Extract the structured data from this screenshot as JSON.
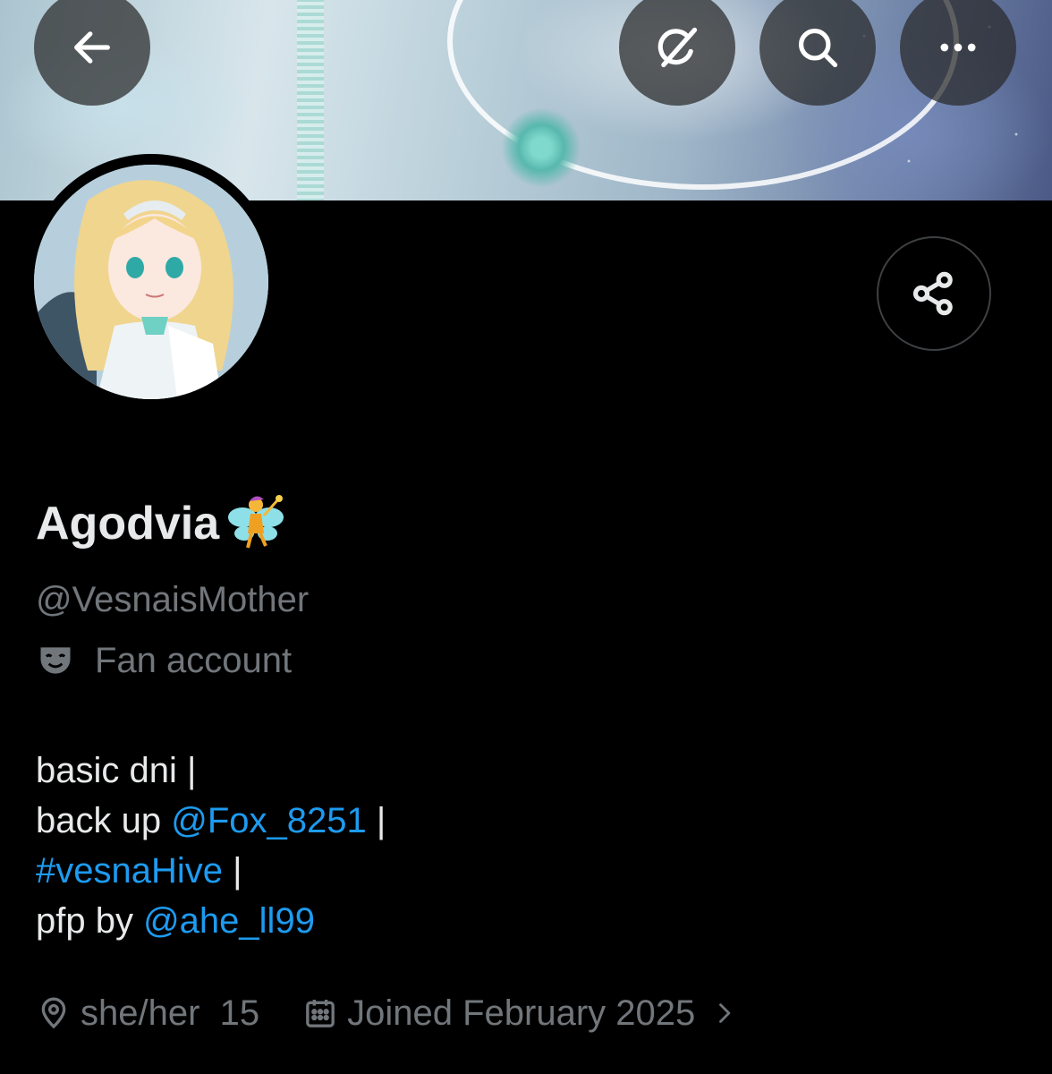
{
  "header": {
    "back_icon": "arrow-left-icon",
    "grok_icon": "grok-icon",
    "search_icon": "search-icon",
    "more_icon": "more-horizontal-icon"
  },
  "profile": {
    "display_name": "Agodvia",
    "display_name_emoji": "fairy-emoji",
    "handle": "@VesnaisMother",
    "category": "Fan account",
    "category_icon": "theater-mask-icon",
    "share_icon": "share-icon"
  },
  "bio": {
    "line1": "basic dni |",
    "line2_prefix": "back up ",
    "line2_link": "@Fox_8251",
    "line2_suffix": " |",
    "line3_link": "#vesnaHive",
    "line3_suffix": " |",
    "line4_prefix": "pfp by ",
    "line4_link": "@ahe_ll99"
  },
  "meta": {
    "location": "she/her  15",
    "location_icon": "location-pin-icon",
    "joined": "Joined February 2025",
    "joined_icon": "calendar-icon",
    "chevron_icon": "chevron-right-icon"
  },
  "colors": {
    "background": "#000000",
    "text_primary": "#e7e9ea",
    "text_secondary": "#71767b",
    "link": "#1d9bf0"
  }
}
